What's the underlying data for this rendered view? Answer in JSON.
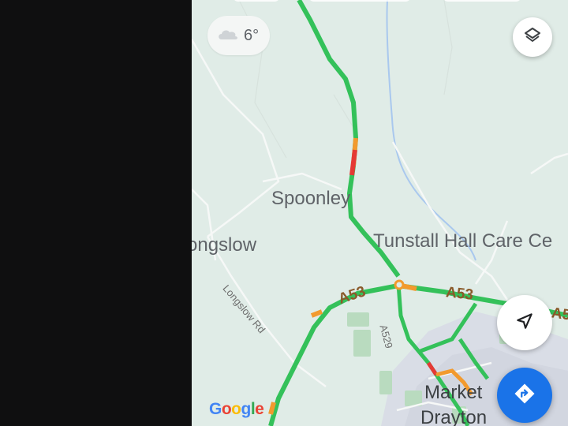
{
  "weather": {
    "temperature": "6°",
    "icon": "cloud-icon"
  },
  "map": {
    "places": {
      "spoonley": "Spoonley",
      "longslow": "ongslow",
      "tunstall": "Tunstall Hall Care Ce",
      "market": "Market",
      "drayton": "Drayton"
    },
    "roads": {
      "a53_west": "A53",
      "a53_east": "A53",
      "a53_edge": "A5",
      "a529": "A529",
      "longslow_rd": "Longslow Rd"
    },
    "traffic_colors": {
      "free": "#34c15a",
      "slow": "#f29a2e",
      "heavy": "#e53935"
    }
  },
  "controls": {
    "layers_icon": "layers-icon",
    "navigate_icon": "navigation-arrow-icon",
    "directions_icon": "directions-icon"
  },
  "branding": {
    "logo_letters": [
      "G",
      "o",
      "o",
      "g",
      "l",
      "e"
    ],
    "logo_colors": [
      "#4285f4",
      "#ea4335",
      "#fbbc05",
      "#4285f4",
      "#34a853",
      "#ea4335"
    ]
  }
}
